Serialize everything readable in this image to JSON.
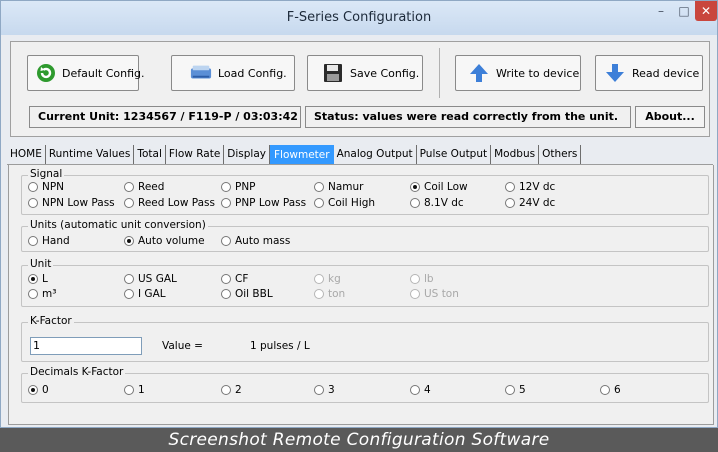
{
  "window": {
    "title": "F-Series Configuration",
    "min": "–",
    "max": "□",
    "close": "✕"
  },
  "toolbar": {
    "default_label": "Default Config.",
    "load_label": "Load Config.",
    "save_label": "Save Config.",
    "write_label": "Write to device",
    "read_label": "Read device"
  },
  "status": {
    "current_unit": "Current Unit: 1234567 / F119-P / 03:03:42",
    "message": "Status: values were read correctly from the unit.",
    "about_label": "About..."
  },
  "tabs": [
    "HOME",
    "Runtime Values",
    "Total",
    "Flow Rate",
    "Display",
    "Flowmeter",
    "Analog Output",
    "Pulse Output",
    "Modbus",
    "Others"
  ],
  "active_tab": "Flowmeter",
  "signal": {
    "title": "Signal",
    "options": [
      "NPN",
      "Reed",
      "PNP",
      "Namur",
      "Coil Low",
      "12V dc",
      "NPN Low Pass",
      "Reed Low Pass",
      "PNP Low Pass",
      "Coil High",
      "8.1V dc",
      "24V dc"
    ],
    "selected": "Coil Low"
  },
  "units_conv": {
    "title": "Units (automatic unit conversion)",
    "options": [
      "Hand",
      "Auto volume",
      "Auto mass"
    ],
    "selected": "Auto volume"
  },
  "unit": {
    "title": "Unit",
    "options": [
      "L",
      "US GAL",
      "CF",
      "kg",
      "lb",
      "m³",
      "I GAL",
      "Oil BBL",
      "ton",
      "US ton"
    ],
    "selected": "L"
  },
  "kfactor": {
    "title": "K-Factor",
    "input_value": "1",
    "value_label": "Value =",
    "value_text": "1 pulses / L"
  },
  "decimals": {
    "title": "Decimals K-Factor",
    "options": [
      "0",
      "1",
      "2",
      "3",
      "4",
      "5",
      "6"
    ],
    "selected": "0"
  },
  "caption": "Screenshot Remote Configuration Software",
  "colors": {
    "active_tab": "#3399ff",
    "close_button": "#c9463d",
    "caption_bg": "#5a5a5a"
  }
}
